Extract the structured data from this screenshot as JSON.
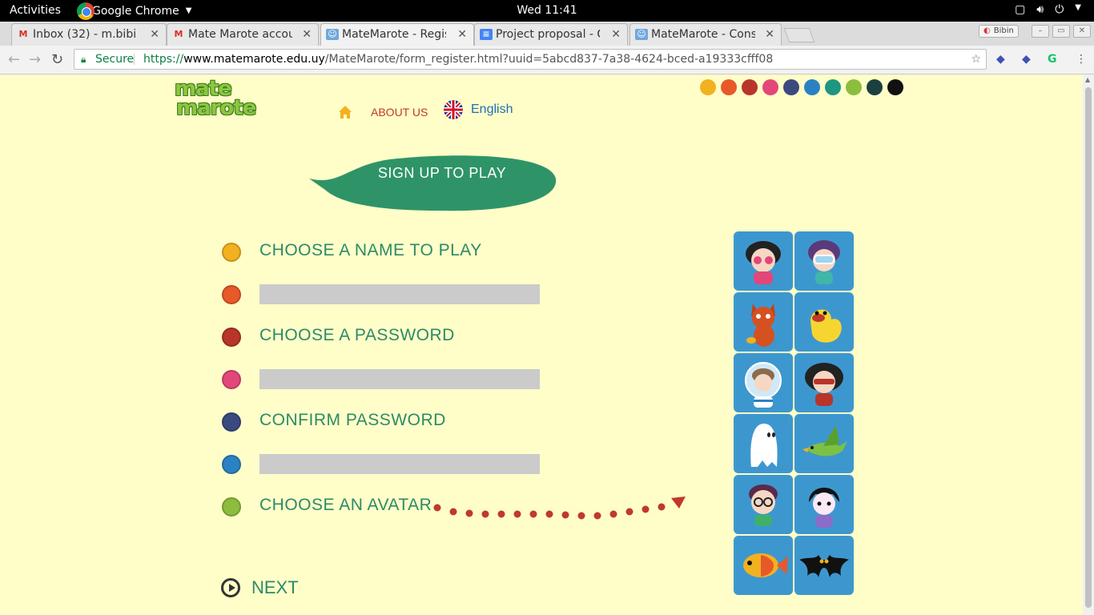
{
  "topbar": {
    "activities": "Activities",
    "app_name": "Google Chrome",
    "clock": "Wed 11:41"
  },
  "tabs": [
    {
      "title": "Inbox (32) - m.bibin",
      "icon": "gmail-icon",
      "active": false
    },
    {
      "title": "Mate Marote accou",
      "icon": "gmail-icon",
      "active": false
    },
    {
      "title": "MateMarote - Regis",
      "icon": "matemarote-icon",
      "active": true
    },
    {
      "title": "Project proposal - G",
      "icon": "docs-icon",
      "active": false
    },
    {
      "title": "MateMarote - Cons",
      "icon": "matemarote-icon",
      "active": false
    }
  ],
  "profile": {
    "label": "Bibin"
  },
  "omnibox": {
    "secure_label": "Secure",
    "url_scheme": "https://",
    "url_host": "www.matemarote.edu.uy",
    "url_path": "/MateMarote/form_register.html?uuid=5abcd837-7a38-4624-bced-a19333cfff08"
  },
  "page": {
    "logo_line1": "mate",
    "logo_line2": "marote",
    "nav": {
      "about_us": "ABOUT US",
      "language": "English"
    },
    "palette_colors": [
      "#f2b120",
      "#e8592a",
      "#b8352a",
      "#e2477a",
      "#3b4a7e",
      "#2a82c3",
      "#1e9682",
      "#8cbd3c",
      "#1c3f3f",
      "#111111"
    ],
    "signup_title": "SIGN UP TO PLAY",
    "form": {
      "name_label": "CHOOSE A NAME TO PLAY",
      "name_value": "",
      "password_label": "CHOOSE A PASSWORD",
      "password_value": "",
      "confirm_label": "CONFIRM PASSWORD",
      "confirm_value": "",
      "avatar_label": "CHOOSE AN AVATAR"
    },
    "dot_colors": [
      "#f2b120",
      "#e8592a",
      "#b8352a",
      "#e2477a",
      "#3b4a7e",
      "#2a82c3",
      "#8cbd3c"
    ],
    "next_label": "NEXT",
    "avatars": [
      "girl-sunglasses",
      "diver-kid",
      "cat-with-fish",
      "yellow-duck",
      "astronaut-kid",
      "masked-hero-girl",
      "ghost",
      "green-bird",
      "kid-with-glasses",
      "vampire-kid",
      "orange-fish",
      "black-bat"
    ]
  }
}
